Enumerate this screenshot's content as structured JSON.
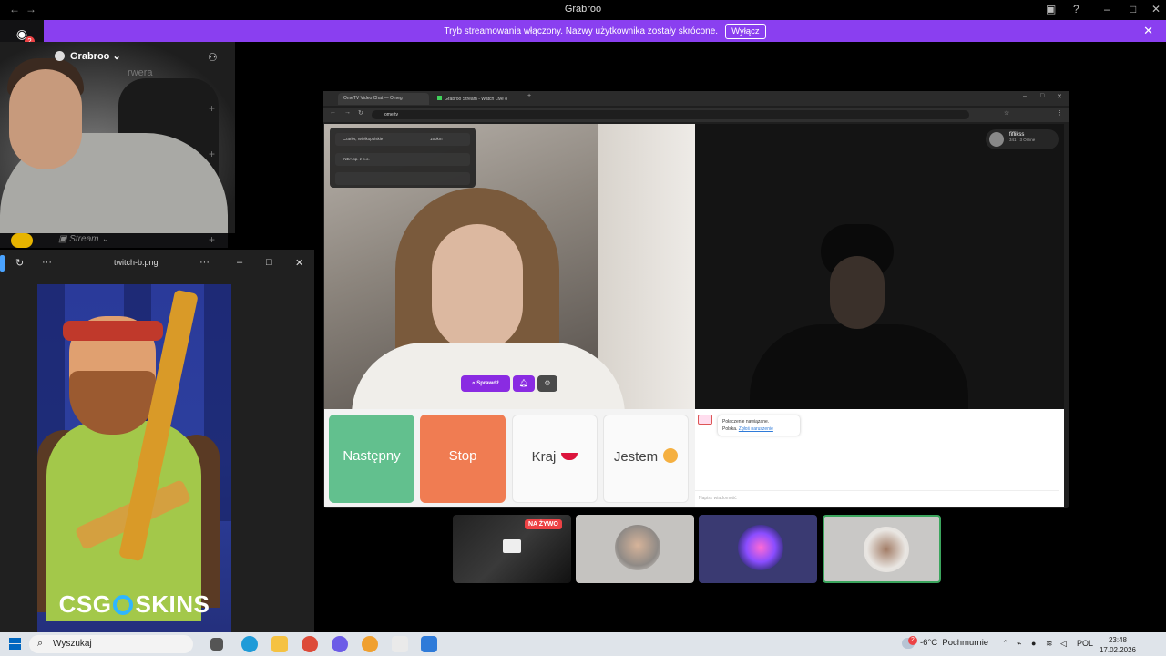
{
  "titlebar": {
    "title": "Grabroo"
  },
  "banner": {
    "text": "Tryb streamowania włączony. Nazwy użytkownika zostały skrócone.",
    "button": "Wyłącz"
  },
  "discord": {
    "badge_count": "2",
    "server_name": "Grabroo",
    "truncated_channel": "rwera",
    "stream_channel": "Stream"
  },
  "viewer": {
    "filename": "twitch-b.png",
    "promo_text_left": "CSG",
    "promo_text_right": "SKINS"
  },
  "browser": {
    "tabs": [
      {
        "label": "OmeTV Video Chat — Omeg"
      },
      {
        "label": "Grabroo Stream - Watch Live o"
      }
    ],
    "url": "ome.tv"
  },
  "ometv": {
    "filters": [
      {
        "label": "Czarlet, Wielkopolskie",
        "value": "150km"
      },
      {
        "label": "INEA sp. z o.o.",
        "value": ""
      },
      {
        "label": "",
        "value": ""
      }
    ],
    "profile": {
      "name": "fiflikss",
      "likes": "341",
      "online": "3 Online"
    },
    "sprawdz": "Sprawdź",
    "controls": {
      "next": "Następny",
      "stop": "Stop",
      "country": "Kraj",
      "gender": "Jestem"
    },
    "chat": {
      "connected": "Połączenie nawiązane.",
      "country": "Polska.",
      "report": "Zgłoś naruszenie",
      "placeholder": "Napisz wiadomość"
    }
  },
  "tiles": {
    "live_label": "NA ŻYWO"
  },
  "taskbar": {
    "search_placeholder": "Wyszukaj",
    "weather_badge": "2",
    "temperature": "-6°C",
    "weather": "Pochmurnie",
    "language": "POL",
    "time": "23:48",
    "date": "17.02.2026"
  },
  "icons": {
    "back": "arrow-left-icon",
    "forward": "arrow-right-icon",
    "search": "search-icon",
    "close": "close-icon",
    "bell": "bell-icon",
    "gear": "gear-icon",
    "screen-share": "screen-share-icon"
  },
  "colors": {
    "banner": "#8a3ff0",
    "next": "#62c08e",
    "stop": "#f07c52",
    "accent_purple": "#8a2be2",
    "live_red": "#ed4245"
  }
}
